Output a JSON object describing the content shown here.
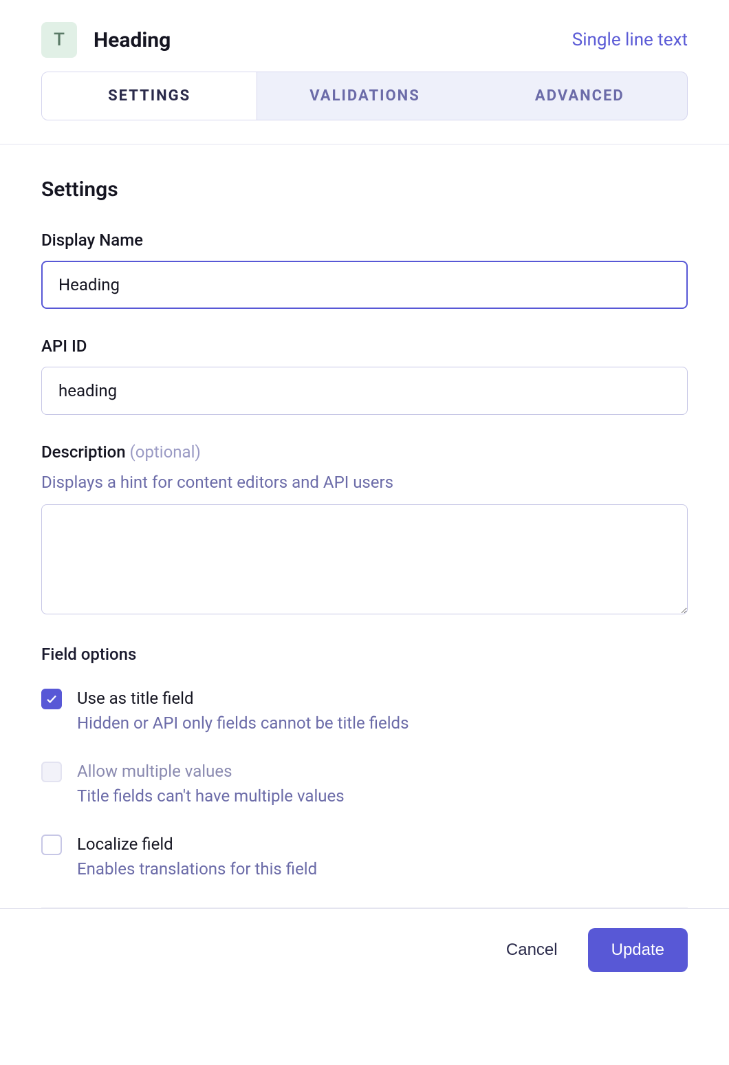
{
  "header": {
    "badge_letter": "T",
    "title": "Heading",
    "type_label": "Single line text"
  },
  "tabs": {
    "items": [
      "SETTINGS",
      "VALIDATIONS",
      "ADVANCED"
    ],
    "active_index": 0
  },
  "settings": {
    "section_title": "Settings",
    "display_name": {
      "label": "Display Name",
      "value": "Heading"
    },
    "api_id": {
      "label": "API ID",
      "value": "heading"
    },
    "description": {
      "label": "Description",
      "optional": "(optional)",
      "hint": "Displays a hint for content editors and API users",
      "value": ""
    },
    "field_options": {
      "title": "Field options",
      "items": [
        {
          "label": "Use as title field",
          "desc": "Hidden or API only fields cannot be title fields",
          "checked": true,
          "disabled": false
        },
        {
          "label": "Allow multiple values",
          "desc": "Title fields can't have multiple values",
          "checked": false,
          "disabled": true
        },
        {
          "label": "Localize field",
          "desc": "Enables translations for this field",
          "checked": false,
          "disabled": false
        }
      ]
    }
  },
  "footer": {
    "cancel": "Cancel",
    "update": "Update"
  }
}
